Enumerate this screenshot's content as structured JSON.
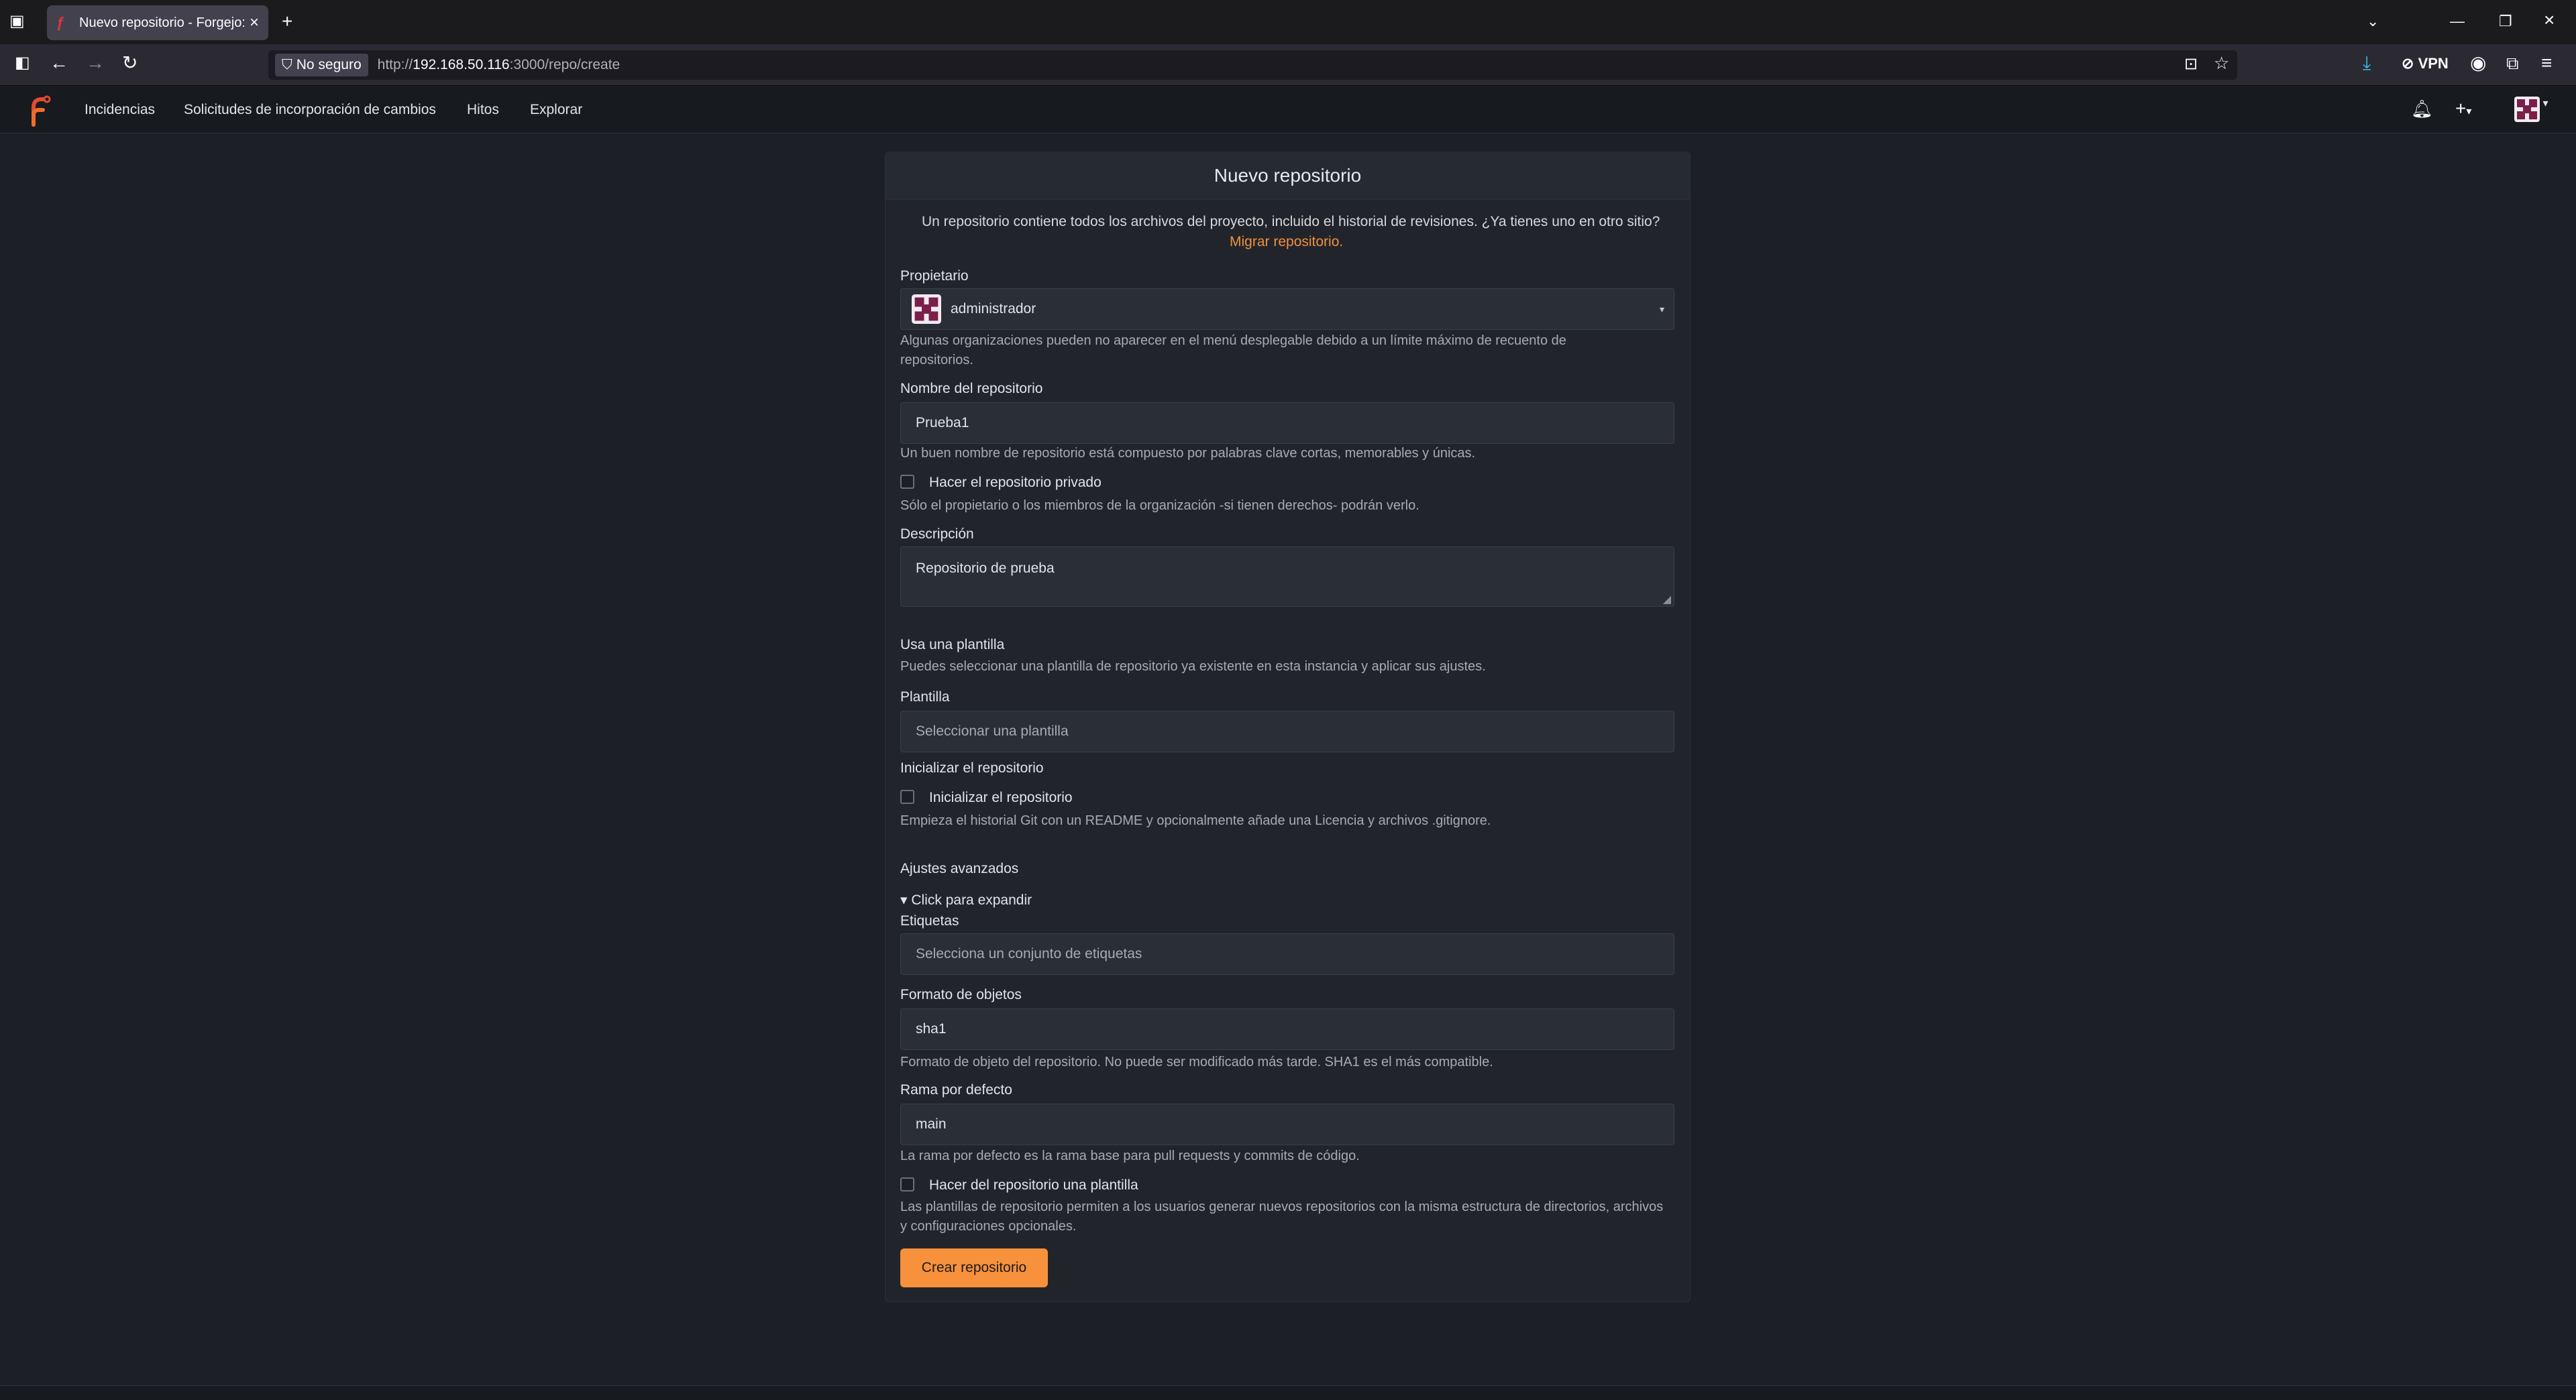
{
  "browser": {
    "tab_title": "Nuevo repositorio - Forgejo: Be",
    "not_secure_label": "No seguro",
    "url_prefix": "http://",
    "url_host": "192.168.50.116",
    "url_rest": ":3000/repo/create",
    "vpn_label": "VPN"
  },
  "header": {
    "nav": [
      "Incidencias",
      "Solicitudes de incorporación de cambios",
      "Hitos",
      "Explorar"
    ]
  },
  "form": {
    "title": "Nuevo repositorio",
    "intro": "Un repositorio contiene todos los archivos del proyecto, incluido el historial de revisiones. ¿Ya tienes uno en otro sitio?",
    "migrate_link": "Migrar repositorio.",
    "owner_label": "Propietario",
    "owner_value": "administrador",
    "owner_help": "Algunas organizaciones pueden no aparecer en el menú desplegable debido a un límite máximo de recuento de repositorios.",
    "name_label": "Nombre del repositorio",
    "name_value": "Prueba1",
    "name_help": "Un buen nombre de repositorio está compuesto por palabras clave cortas, memorables y únicas.",
    "private_label": "Hacer el repositorio privado",
    "private_help": "Sólo el propietario o los miembros de la organización -si tienen derechos- podrán verlo.",
    "description_label": "Descripción",
    "description_value": "Repositorio de prueba",
    "template_section": "Usa una plantilla",
    "template_section_help": "Puedes seleccionar una plantilla de repositorio ya existente en esta instancia y aplicar sus ajustes.",
    "template_label": "Plantilla",
    "template_placeholder": "Seleccionar una plantilla",
    "init_section": "Inicializar el repositorio",
    "init_label": "Inicializar el repositorio",
    "init_help": "Empieza el historial Git con un README y opcionalmente añade una Licencia y archivos .gitignore.",
    "advanced_section": "Ajustes avanzados",
    "advanced_toggle": "▾ Click para expandir",
    "labels_label": "Etiquetas",
    "labels_placeholder": "Selecciona un conjunto de etiquetas",
    "object_format_label": "Formato de objetos",
    "object_format_value": "sha1",
    "object_format_help": "Formato de objeto del repositorio. No puede ser modificado más tarde. SHA1 es el más compatible.",
    "default_branch_label": "Rama por defecto",
    "default_branch_value": "main",
    "default_branch_help": "La rama por defecto es la rama base para pull requests y commits de código.",
    "template_repo_label": "Hacer del repositorio una plantilla",
    "template_repo_help": "Las plantillas de repositorio permiten a los usuarios generar nuevos repositorios con la misma estructura de directorios, archivos y configuraciones opcionales.",
    "submit_label": "Crear repositorio"
  },
  "colors": {
    "accent": "#f7913b",
    "background": "#1c1f25",
    "panel": "#21252b"
  }
}
